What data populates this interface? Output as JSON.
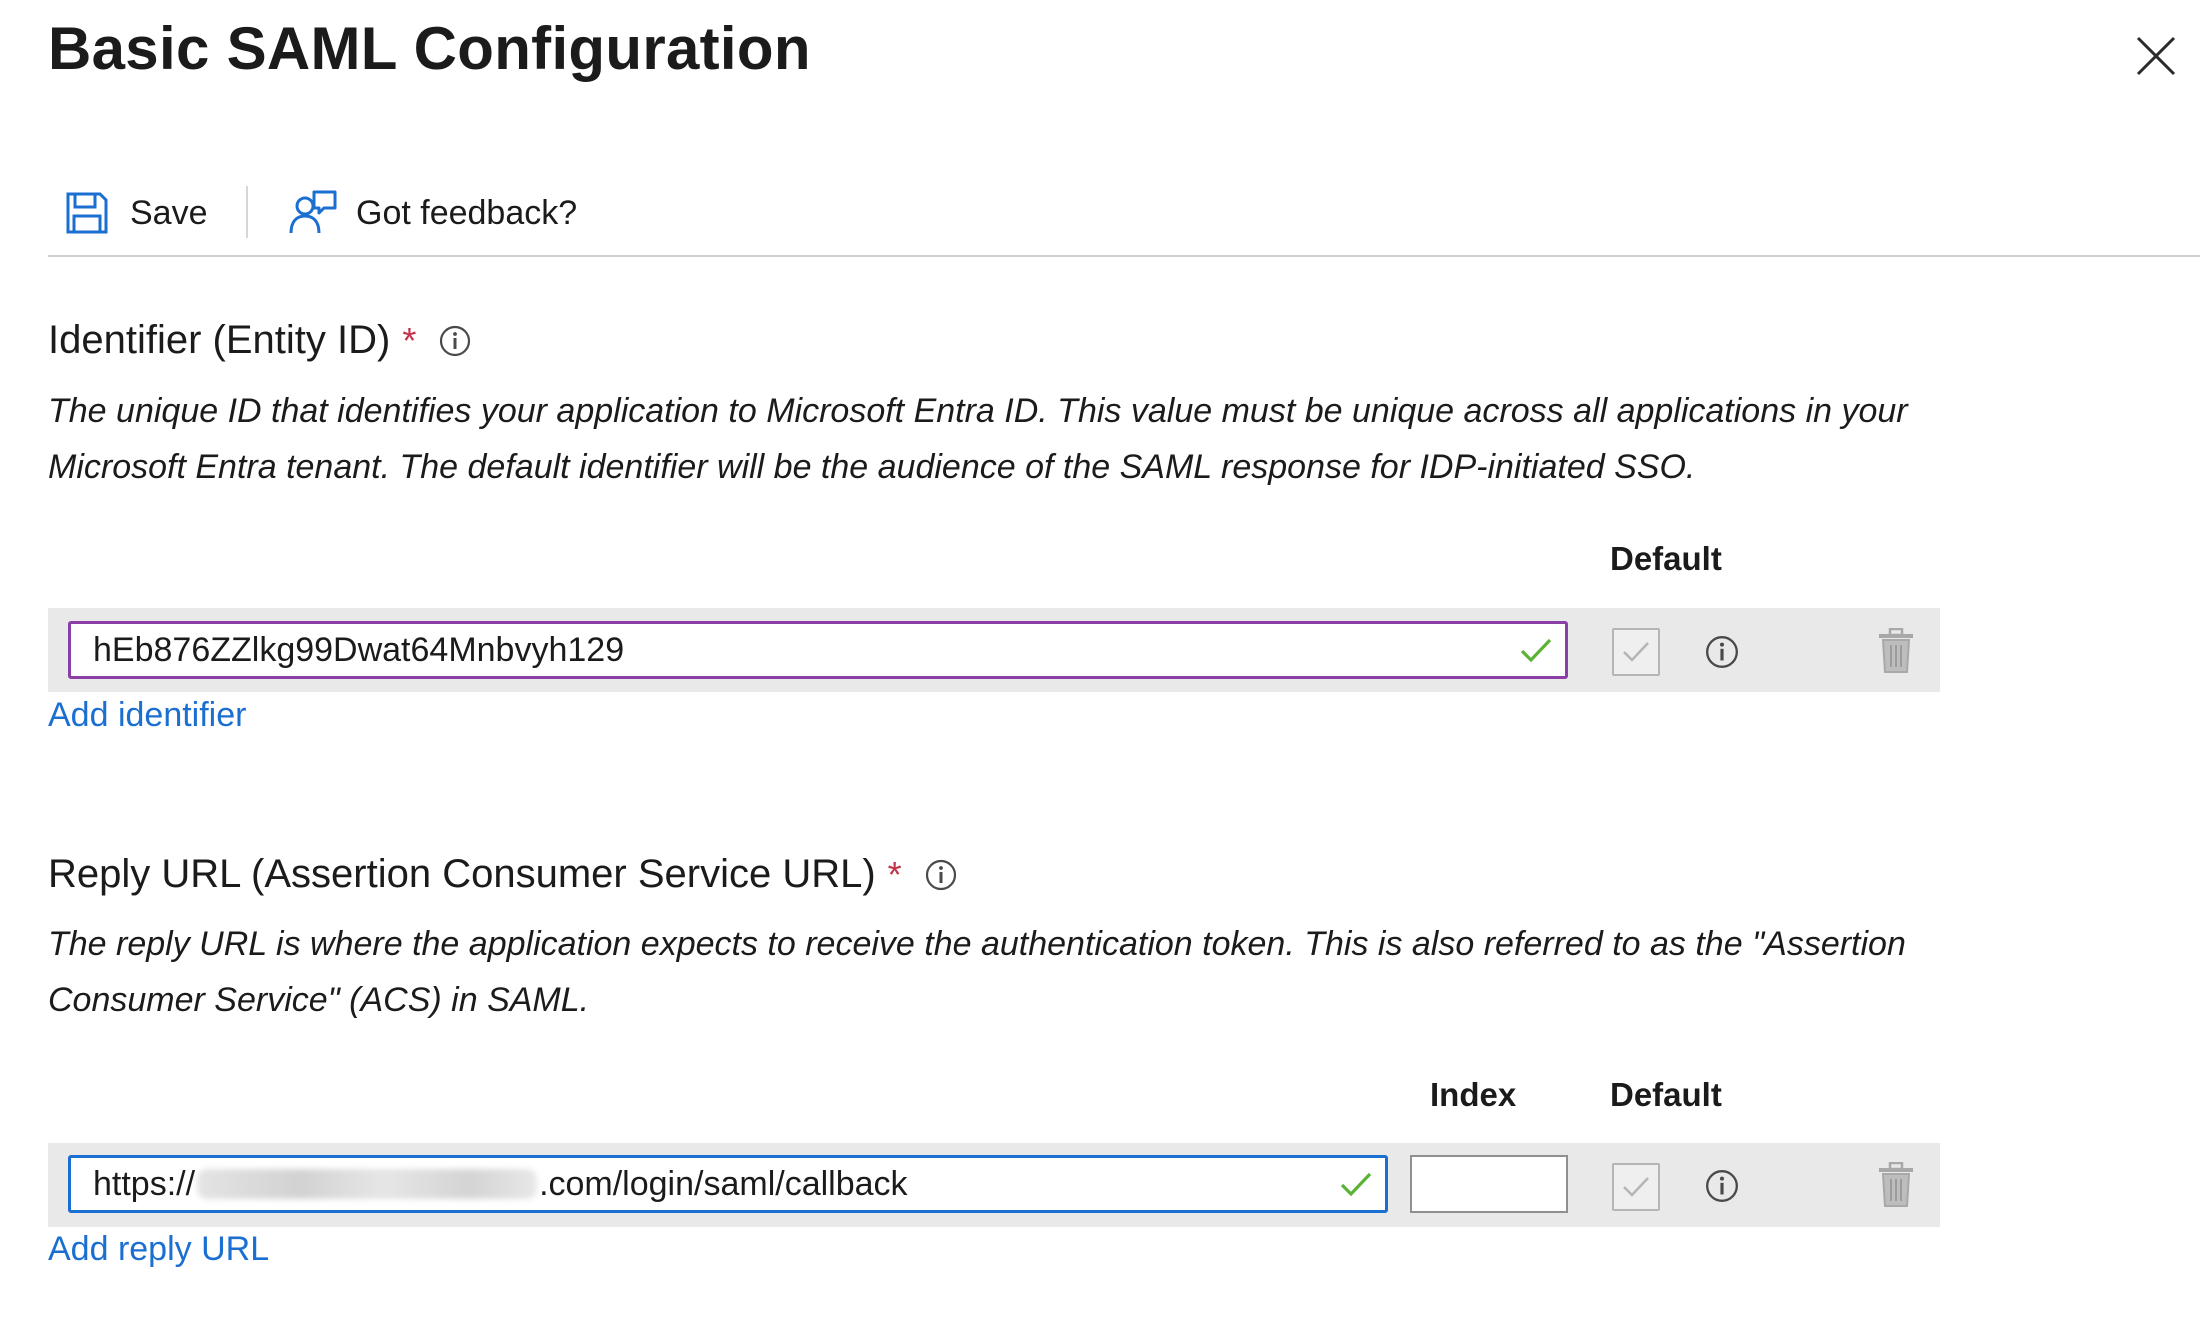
{
  "header": {
    "title": "Basic SAML Configuration"
  },
  "toolbar": {
    "save_label": "Save",
    "feedback_label": "Got feedback?"
  },
  "identifier_section": {
    "label": "Identifier (Entity ID)",
    "required_marker": "*",
    "description_line1": "The unique ID that identifies your application to Microsoft Entra ID. This value must be unique across all applications in your",
    "description_line2": "Microsoft Entra tenant. The default identifier will be the audience of the SAML response for IDP-initiated SSO.",
    "default_header": "Default",
    "value": "hEb876ZZlkg99Dwat64Mnbvyh129",
    "add_link": "Add identifier"
  },
  "reply_section": {
    "label": "Reply URL (Assertion Consumer Service URL)",
    "required_marker": "*",
    "description_line1": "The reply URL is where the application expects to receive the authentication token. This is also referred to as the \"Assertion",
    "description_line2": "Consumer Service\" (ACS) in SAML.",
    "index_header": "Index",
    "default_header": "Default",
    "value_prefix": "https://",
    "value_suffix": ".com/login/saml/callback",
    "index_value": "",
    "add_link": "Add reply URL"
  },
  "colors": {
    "accent_link": "#1a6fd1",
    "required": "#c4314b",
    "valid_check": "#5bb336",
    "identifier_focus_border": "#8a3fa6",
    "reply_focus_border": "#1a6fd1",
    "row_background": "#e9e9e9"
  },
  "icons": {
    "close": "close-icon",
    "save": "save-icon",
    "feedback": "feedback-icon",
    "info": "info-icon",
    "valid": "checkmark-icon",
    "delete": "trash-icon"
  }
}
